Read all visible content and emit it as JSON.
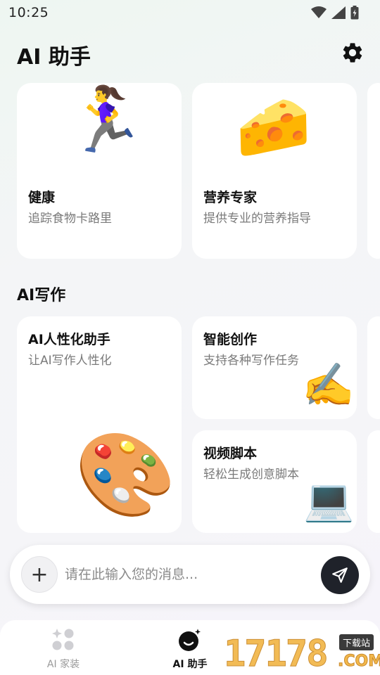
{
  "status_bar": {
    "time": "10:25"
  },
  "header": {
    "title": "AI 助手",
    "settings_icon": "gear-icon"
  },
  "top_cards": [
    {
      "emoji": "🏃‍♀️",
      "title": "健康",
      "desc": "追踪食物卡路里"
    },
    {
      "emoji": "🧀",
      "title": "营养专家",
      "desc": "提供专业的营养指导"
    }
  ],
  "writing_section": {
    "title": "AI写作",
    "cards": [
      {
        "emoji": "🎨",
        "title": "AI人性化助手",
        "desc": "让AI写作人性化"
      },
      {
        "emoji": "✍️",
        "title": "智能创作",
        "desc": "支持各种写作任务"
      },
      {
        "emoji": "💻",
        "title": "视频脚本",
        "desc": "轻松生成创意脚本"
      }
    ]
  },
  "input_bar": {
    "placeholder": "请在此输入您的消息...",
    "plus_label": "+"
  },
  "bottom_nav": [
    {
      "label": "AI 家装",
      "icon": "grid-icon",
      "active": false
    },
    {
      "label": "AI 助手",
      "icon": "assistant-icon",
      "active": true
    }
  ],
  "watermark": {
    "digits": "17178",
    "tag": "下载站",
    "suffix": ".COM"
  },
  "colors": {
    "accent_dark": "#1f222a",
    "muted_text": "#7a7a7a",
    "inactive_nav": "#9a9a9a"
  }
}
